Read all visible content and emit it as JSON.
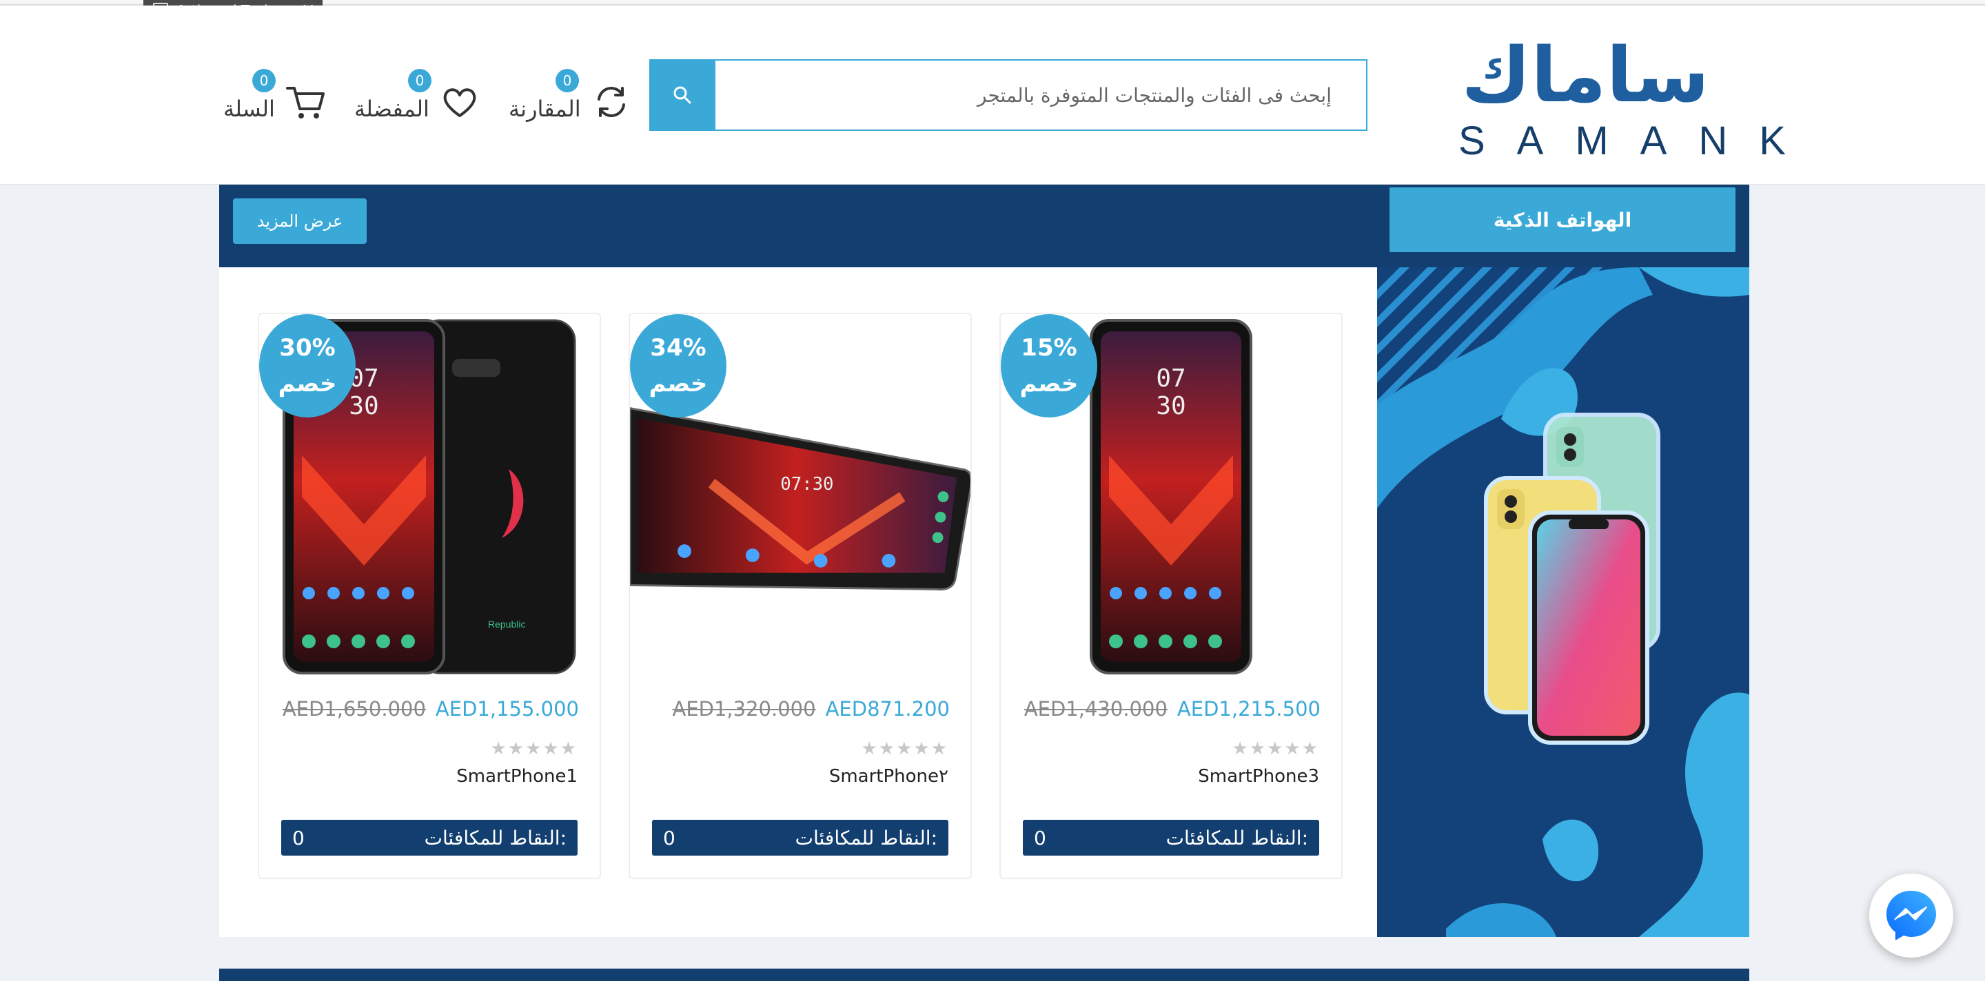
{
  "tooltip": {
    "label": "Artboard Tool",
    "shortcut": "V"
  },
  "brand": {
    "name_ar": "ساماك",
    "name_en": "SAMANK"
  },
  "search": {
    "placeholder": "إبحث فى الفئات والمنتجات المتوفرة بالمتجر"
  },
  "header_actions": {
    "compare": {
      "label": "المقارنة",
      "count": "0"
    },
    "favorites": {
      "label": "المفضلة",
      "count": "0"
    },
    "cart": {
      "label": "السلة",
      "count": "0"
    }
  },
  "section": {
    "category_tab": "الهواتف الذكية",
    "more_button": "عرض المزيد"
  },
  "products": [
    {
      "name": "SmartPhone3",
      "discount_pct": "15%",
      "discount_word": "خصم",
      "price_new": "AED1,215.500",
      "price_old": "AED1,430.000",
      "rating": 0,
      "points_label": "النقاط للمكافئات:",
      "points": "0"
    },
    {
      "name": "SmartPhone٢",
      "discount_pct": "34%",
      "discount_word": "خصم",
      "price_new": "AED871.200",
      "price_old": "AED1,320.000",
      "rating": 0,
      "points_label": "النقاط للمكافئات:",
      "points": "0"
    },
    {
      "name": "SmartPhone1",
      "discount_pct": "30%",
      "discount_word": "خصم",
      "price_new": "AED1,155.000",
      "price_old": "AED1,650.000",
      "rating": 0,
      "points_label": "النقاط للمكافئات:",
      "points": "0"
    }
  ],
  "stars": "★★★★★",
  "colors": {
    "accent": "#3aa9d8",
    "navy": "#123f6f",
    "banner": "#13417a"
  },
  "icons": [
    "search-icon",
    "compare-icon",
    "heart-icon",
    "cart-icon",
    "messenger-icon",
    "star-icon"
  ]
}
